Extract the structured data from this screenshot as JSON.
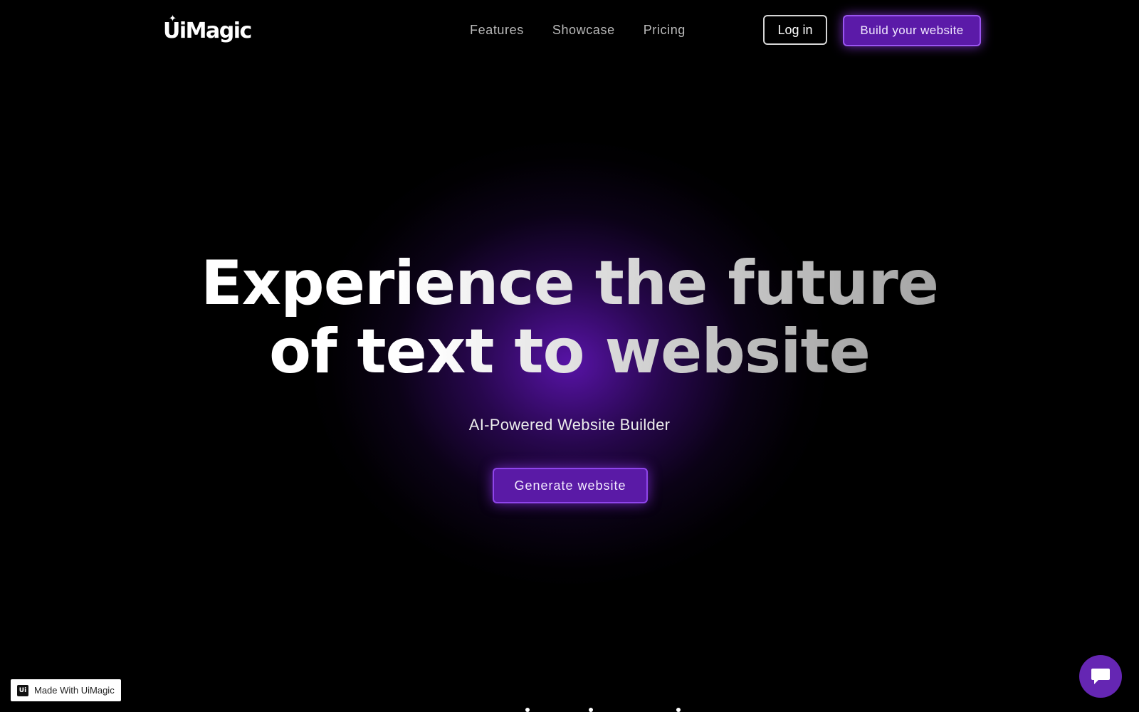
{
  "header": {
    "logo": "UiMagic",
    "nav": [
      "Features",
      "Showcase",
      "Pricing"
    ],
    "login_label": "Log in",
    "cta_label": "Build your website"
  },
  "hero": {
    "title_line1_a": "Experience the ",
    "title_line1_b": "future",
    "title_line2_a": "of text to ",
    "title_line2_b": "website",
    "subtitle": "AI-Powered Website Builder",
    "button_label": "Generate website"
  },
  "badge": {
    "label": "Made With UiMagic",
    "icon_text": "Ui"
  },
  "chat": {
    "icon": "chat-bubble-icon"
  },
  "colors": {
    "background": "#000000",
    "accent": "#5b1aa8",
    "accent_border": "#9a55f0",
    "glow": "#5c14af"
  }
}
